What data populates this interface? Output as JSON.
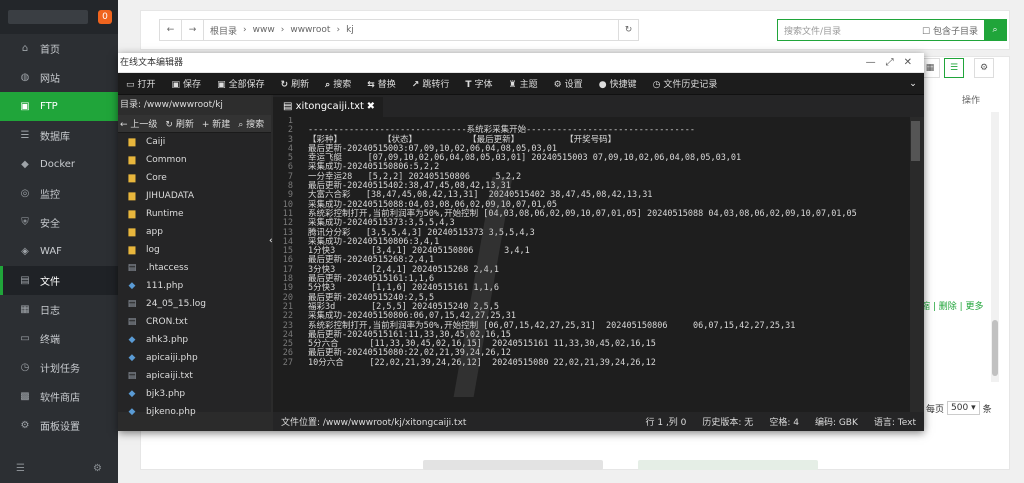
{
  "sidebar": {
    "badge": "0",
    "items": [
      {
        "label": "首页",
        "icon": "home-icon",
        "glyph": "⌂"
      },
      {
        "label": "网站",
        "icon": "globe-icon",
        "glyph": "◍"
      },
      {
        "label": "FTP",
        "icon": "ftp-icon",
        "glyph": "▣"
      },
      {
        "label": "数据库",
        "icon": "database-icon",
        "glyph": "☰"
      },
      {
        "label": "Docker",
        "icon": "docker-icon",
        "glyph": "◆"
      },
      {
        "label": "监控",
        "icon": "monitor-icon",
        "glyph": "◎"
      },
      {
        "label": "安全",
        "icon": "shield-icon",
        "glyph": "⛨"
      },
      {
        "label": "WAF",
        "icon": "waf-icon",
        "glyph": "◈"
      },
      {
        "label": "文件",
        "icon": "folder-icon",
        "glyph": "▤"
      },
      {
        "label": "日志",
        "icon": "log-icon",
        "glyph": "▦"
      },
      {
        "label": "终端",
        "icon": "terminal-icon",
        "glyph": "▭"
      },
      {
        "label": "计划任务",
        "icon": "clock-icon",
        "glyph": "◷"
      },
      {
        "label": "软件商店",
        "icon": "store-icon",
        "glyph": "▩"
      },
      {
        "label": "面板设置",
        "icon": "settings-icon",
        "glyph": "⚙"
      }
    ]
  },
  "breadcrumb": {
    "parts": [
      "根目录",
      "www",
      "wwwroot",
      "kj"
    ]
  },
  "search": {
    "placeholder": "搜索文件/目录",
    "subdir_label": "包含子目录"
  },
  "table": {
    "op_header": "操作",
    "row_actions": "压缩 | 删除 | 更多"
  },
  "pager": {
    "per_page_label": "每页",
    "per_page": "500",
    "unit": "条"
  },
  "editor": {
    "title": "在线文本编辑器",
    "toolbar": [
      {
        "label": "打开",
        "icon": "open-icon",
        "glyph": "▭"
      },
      {
        "label": "保存",
        "icon": "save-icon",
        "glyph": "▣"
      },
      {
        "label": "全部保存",
        "icon": "save-all-icon",
        "glyph": "▣"
      },
      {
        "label": "刷新",
        "icon": "refresh-icon",
        "glyph": "↻"
      },
      {
        "label": "搜索",
        "icon": "search-icon",
        "glyph": "⌕"
      },
      {
        "label": "替换",
        "icon": "replace-icon",
        "glyph": "⇆"
      },
      {
        "label": "跳转行",
        "icon": "goto-line-icon",
        "glyph": "↗"
      },
      {
        "label": "字体",
        "icon": "font-icon",
        "glyph": "T"
      },
      {
        "label": "主题",
        "icon": "theme-icon",
        "glyph": "♜"
      },
      {
        "label": "设置",
        "icon": "settings-icon",
        "glyph": "⚙"
      },
      {
        "label": "快捷键",
        "icon": "shortcut-icon",
        "glyph": "●"
      },
      {
        "label": "文件历史记录",
        "icon": "history-icon",
        "glyph": "◷"
      }
    ],
    "dir_path": "目录: /www/wwwroot/kj",
    "file_tools": [
      {
        "label": "上一级",
        "glyph": "←",
        "icon": "up-level-icon"
      },
      {
        "label": "刷新",
        "glyph": "↻",
        "icon": "refresh-icon"
      },
      {
        "label": "新建",
        "glyph": "+",
        "icon": "new-icon"
      },
      {
        "label": "搜索",
        "glyph": "⌕",
        "icon": "search-icon"
      }
    ],
    "files": [
      {
        "name": "Caiji",
        "type": "folder"
      },
      {
        "name": "Common",
        "type": "folder"
      },
      {
        "name": "Core",
        "type": "folder"
      },
      {
        "name": "JIHUADATA",
        "type": "folder"
      },
      {
        "name": "Runtime",
        "type": "folder"
      },
      {
        "name": "app",
        "type": "folder"
      },
      {
        "name": "log",
        "type": "folder"
      },
      {
        "name": ".htaccess",
        "type": "file"
      },
      {
        "name": "111.php",
        "type": "php"
      },
      {
        "name": "24_05_15.log",
        "type": "file"
      },
      {
        "name": "CRON.txt",
        "type": "file"
      },
      {
        "name": "ahk3.php",
        "type": "php"
      },
      {
        "name": "apicaiji.php",
        "type": "php"
      },
      {
        "name": "apicaiji.txt",
        "type": "file"
      },
      {
        "name": "bjk3.php",
        "type": "php"
      },
      {
        "name": "bjkeno.php",
        "type": "php"
      }
    ],
    "tab_name": "xitongcaiji.txt",
    "code_lines": [
      "",
      "-------------------------------系统彩采集开始---------------------------------",
      "【彩种】        【状态】          【最后更新】         【开奖号码】",
      "最后更新-20240515003:07,09,10,02,06,04,08,05,03,01",
      "幸运飞艇     [07,09,10,02,06,04,08,05,03,01] 20240515003 07,09,10,02,06,04,08,05,03,01",
      "采集成功-202405150806:5,2,2",
      "一分幸运28   [5,2,2] 202405150806     5,2,2",
      "最后更新-20240515402:38,47,45,08,42,13,31",
      "大富六合彩   [38,47,45,08,42,13,31]  20240515402 38,47,45,08,42,13,31",
      "采集成功-20240515088:04,03,08,06,02,09,10,07,01,05",
      "系统彩控制打开,当前利润率为50%,开始控制 [04,03,08,06,02,09,10,07,01,05] 20240515088 04,03,08,06,02,09,10,07,01,05",
      "采集成功-20240515373:3,5,5,4,3",
      "腾讯分分彩   [3,5,5,4,3] 20240515373 3,5,5,4,3",
      "采集成功-202405150806:3,4,1",
      "1分快3       [3,4,1] 202405150806      3,4,1",
      "最后更新-20240515268:2,4,1",
      "3分快3       [2,4,1] 20240515268 2,4,1",
      "最后更新-20240515161:1,1,6",
      "5分快3       [1,1,6] 20240515161 1,1,6",
      "最后更新-20240515240:2,5,5",
      "福彩3d       [2,5,5] 20240515240 2,5,5",
      "采集成功-202405150806:06,07,15,42,27,25,31",
      "系统彩控制打开,当前利润率为50%,开始控制 [06,07,15,42,27,25,31]  202405150806     06,07,15,42,27,25,31",
      "最后更新-20240515161:11,33,30,45,02,16,15",
      "5分六合      [11,33,30,45,02,16,15]  20240515161 11,33,30,45,02,16,15",
      "最后更新-20240515080:22,02,21,39,24,26,12",
      "10分六合     [22,02,21,39,24,26,12]  20240515080 22,02,21,39,24,26,12"
    ],
    "status": {
      "file_path": "文件位置: /www/wwwroot/kj/xitongcaiji.txt",
      "cursor": "行 1 ,列 0",
      "history": "历史版本: 无",
      "indent": "空格: 4",
      "encoding": "编码: GBK",
      "language": "语言: Text"
    }
  }
}
